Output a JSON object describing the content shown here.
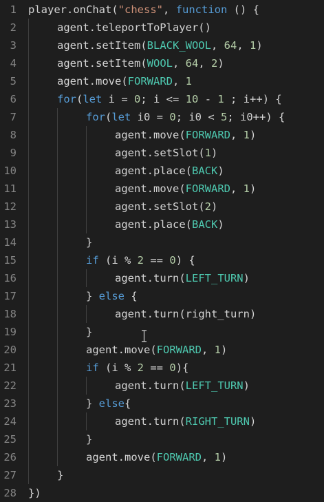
{
  "colors": {
    "background": "#1e1e1e",
    "plain": "#d4d4d4",
    "keyword": "#569cd6",
    "string": "#ce9178",
    "number": "#b5cea8",
    "constant": "#4ec9b0",
    "line_number": "#858585",
    "indent_guide": "#404040"
  },
  "editor": {
    "lines": [
      {
        "n": "1",
        "indent": 0,
        "tokens": [
          {
            "t": "player.onChat(",
            "c": "p"
          },
          {
            "t": "\"chess\"",
            "c": "s"
          },
          {
            "t": ", ",
            "c": "p"
          },
          {
            "t": "function",
            "c": "k"
          },
          {
            "t": " () {",
            "c": "p"
          }
        ]
      },
      {
        "n": "2",
        "indent": 1,
        "tokens": [
          {
            "t": "agent.teleportToPlayer()",
            "c": "p"
          }
        ]
      },
      {
        "n": "3",
        "indent": 1,
        "tokens": [
          {
            "t": "agent.setItem(",
            "c": "p"
          },
          {
            "t": "BLACK_WOOL",
            "c": "e"
          },
          {
            "t": ", ",
            "c": "p"
          },
          {
            "t": "64",
            "c": "n"
          },
          {
            "t": ", ",
            "c": "p"
          },
          {
            "t": "1",
            "c": "n"
          },
          {
            "t": ")",
            "c": "p"
          }
        ]
      },
      {
        "n": "4",
        "indent": 1,
        "tokens": [
          {
            "t": "agent.setItem(",
            "c": "p"
          },
          {
            "t": "WOOL",
            "c": "e"
          },
          {
            "t": ", ",
            "c": "p"
          },
          {
            "t": "64",
            "c": "n"
          },
          {
            "t": ", ",
            "c": "p"
          },
          {
            "t": "2",
            "c": "n"
          },
          {
            "t": ")",
            "c": "p"
          }
        ]
      },
      {
        "n": "5",
        "indent": 1,
        "tokens": [
          {
            "t": "agent.move(",
            "c": "p"
          },
          {
            "t": "FORWARD",
            "c": "e"
          },
          {
            "t": ", ",
            "c": "p"
          },
          {
            "t": "1",
            "c": "n"
          }
        ]
      },
      {
        "n": "6",
        "indent": 1,
        "tokens": [
          {
            "t": "for",
            "c": "k"
          },
          {
            "t": "(",
            "c": "p"
          },
          {
            "t": "let",
            "c": "k"
          },
          {
            "t": " i = ",
            "c": "p"
          },
          {
            "t": "0",
            "c": "n"
          },
          {
            "t": "; i <= ",
            "c": "p"
          },
          {
            "t": "10",
            "c": "n"
          },
          {
            "t": " - ",
            "c": "p"
          },
          {
            "t": "1",
            "c": "n"
          },
          {
            "t": " ; i++) {",
            "c": "p"
          }
        ]
      },
      {
        "n": "7",
        "indent": 2,
        "tokens": [
          {
            "t": "for",
            "c": "k"
          },
          {
            "t": "(",
            "c": "p"
          },
          {
            "t": "let",
            "c": "k"
          },
          {
            "t": " i0 = ",
            "c": "p"
          },
          {
            "t": "0",
            "c": "n"
          },
          {
            "t": "; i0 < ",
            "c": "p"
          },
          {
            "t": "5",
            "c": "n"
          },
          {
            "t": "; i0++) {",
            "c": "p"
          }
        ]
      },
      {
        "n": "8",
        "indent": 3,
        "tokens": [
          {
            "t": "agent.move(",
            "c": "p"
          },
          {
            "t": "FORWARD",
            "c": "e"
          },
          {
            "t": ", ",
            "c": "p"
          },
          {
            "t": "1",
            "c": "n"
          },
          {
            "t": ")",
            "c": "p"
          }
        ]
      },
      {
        "n": "9",
        "indent": 3,
        "tokens": [
          {
            "t": "agent.setSlot(",
            "c": "p"
          },
          {
            "t": "1",
            "c": "n"
          },
          {
            "t": ")",
            "c": "p"
          }
        ]
      },
      {
        "n": "10",
        "indent": 3,
        "tokens": [
          {
            "t": "agent.place(",
            "c": "p"
          },
          {
            "t": "BACK",
            "c": "e"
          },
          {
            "t": ")",
            "c": "p"
          }
        ]
      },
      {
        "n": "11",
        "indent": 3,
        "tokens": [
          {
            "t": "agent.move(",
            "c": "p"
          },
          {
            "t": "FORWARD",
            "c": "e"
          },
          {
            "t": ", ",
            "c": "p"
          },
          {
            "t": "1",
            "c": "n"
          },
          {
            "t": ")",
            "c": "p"
          }
        ]
      },
      {
        "n": "12",
        "indent": 3,
        "tokens": [
          {
            "t": "agent.setSlot(",
            "c": "p"
          },
          {
            "t": "2",
            "c": "n"
          },
          {
            "t": ")",
            "c": "p"
          }
        ]
      },
      {
        "n": "13",
        "indent": 3,
        "tokens": [
          {
            "t": "agent.place(",
            "c": "p"
          },
          {
            "t": "BACK",
            "c": "e"
          },
          {
            "t": ")",
            "c": "p"
          }
        ]
      },
      {
        "n": "14",
        "indent": 2,
        "tokens": [
          {
            "t": "}",
            "c": "p"
          }
        ]
      },
      {
        "n": "15",
        "indent": 2,
        "tokens": [
          {
            "t": "if",
            "c": "k"
          },
          {
            "t": " (i % ",
            "c": "p"
          },
          {
            "t": "2",
            "c": "n"
          },
          {
            "t": " == ",
            "c": "p"
          },
          {
            "t": "0",
            "c": "n"
          },
          {
            "t": ") {",
            "c": "p"
          }
        ]
      },
      {
        "n": "16",
        "indent": 3,
        "tokens": [
          {
            "t": "agent.turn(",
            "c": "p"
          },
          {
            "t": "LEFT_TURN",
            "c": "e"
          },
          {
            "t": ")",
            "c": "p"
          }
        ]
      },
      {
        "n": "17",
        "indent": 2,
        "tokens": [
          {
            "t": "} ",
            "c": "p"
          },
          {
            "t": "else",
            "c": "k"
          },
          {
            "t": " {",
            "c": "p"
          }
        ]
      },
      {
        "n": "18",
        "indent": 3,
        "tokens": [
          {
            "t": "agent.turn(right_turn)",
            "c": "p"
          }
        ]
      },
      {
        "n": "19",
        "indent": 2,
        "tokens": [
          {
            "t": "}",
            "c": "p"
          }
        ]
      },
      {
        "n": "20",
        "indent": 2,
        "tokens": [
          {
            "t": "agent.move(",
            "c": "p"
          },
          {
            "t": "FORWARD",
            "c": "e"
          },
          {
            "t": ", ",
            "c": "p"
          },
          {
            "t": "1",
            "c": "n"
          },
          {
            "t": ")",
            "c": "p"
          }
        ]
      },
      {
        "n": "21",
        "indent": 2,
        "tokens": [
          {
            "t": "if",
            "c": "k"
          },
          {
            "t": " (i % ",
            "c": "p"
          },
          {
            "t": "2",
            "c": "n"
          },
          {
            "t": " == ",
            "c": "p"
          },
          {
            "t": "0",
            "c": "n"
          },
          {
            "t": "){",
            "c": "p"
          }
        ]
      },
      {
        "n": "22",
        "indent": 3,
        "tokens": [
          {
            "t": "agent.turn(",
            "c": "p"
          },
          {
            "t": "LEFT_TURN",
            "c": "e"
          },
          {
            "t": ")",
            "c": "p"
          }
        ]
      },
      {
        "n": "23",
        "indent": 2,
        "tokens": [
          {
            "t": "} ",
            "c": "p"
          },
          {
            "t": "else",
            "c": "k"
          },
          {
            "t": "{",
            "c": "p"
          }
        ]
      },
      {
        "n": "24",
        "indent": 3,
        "tokens": [
          {
            "t": "agent.turn(",
            "c": "p"
          },
          {
            "t": "RIGHT_TURN",
            "c": "e"
          },
          {
            "t": ")",
            "c": "p"
          }
        ]
      },
      {
        "n": "25",
        "indent": 2,
        "tokens": [
          {
            "t": "}",
            "c": "p"
          }
        ]
      },
      {
        "n": "26",
        "indent": 2,
        "tokens": [
          {
            "t": "agent.move(",
            "c": "p"
          },
          {
            "t": "FORWARD",
            "c": "e"
          },
          {
            "t": ", ",
            "c": "p"
          },
          {
            "t": "1",
            "c": "n"
          },
          {
            "t": ")",
            "c": "p"
          }
        ]
      },
      {
        "n": "27",
        "indent": 1,
        "tokens": [
          {
            "t": "}",
            "c": "p"
          }
        ]
      },
      {
        "n": "28",
        "indent": 0,
        "tokens": [
          {
            "t": "})",
            "c": "p"
          }
        ]
      }
    ],
    "cursor_icon": "text-cursor-icon"
  }
}
